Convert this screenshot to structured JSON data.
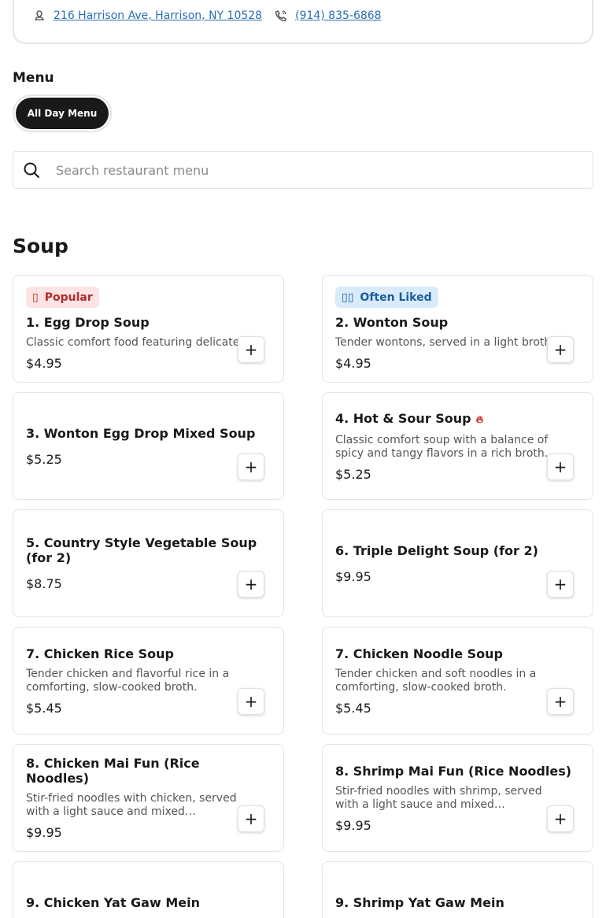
{
  "info": {
    "address": "216 Harrison Ave, Harrison, NY 10528",
    "phone": "(914) 835-6868"
  },
  "menu": {
    "heading": "Menu",
    "tab_label": "All Day Menu"
  },
  "search": {
    "placeholder": "Search restaurant menu"
  },
  "section": {
    "title": "Soup"
  },
  "badges": {
    "popular": "Popular",
    "often_liked": "Often Liked"
  },
  "items": [
    {
      "name": "1. Egg Drop Soup",
      "desc": "Classic comfort food featuring delicate ...",
      "price": "$4.95"
    },
    {
      "name": "2. Wonton Soup",
      "desc": "Tender wontons, served in a light broth.",
      "price": "$4.95"
    },
    {
      "name": "3. Wonton Egg Drop Mixed Soup",
      "desc": "",
      "price": "$5.25"
    },
    {
      "name": "4. Hot & Sour Soup",
      "desc": "Classic comfort soup with a balance of spicy and tangy flavors in a rich broth.",
      "price": "$5.25"
    },
    {
      "name": "5. Country Style Vegetable Soup (for 2)",
      "desc": "",
      "price": "$8.75"
    },
    {
      "name": "6. Triple Delight Soup (for 2)",
      "desc": "",
      "price": "$9.95"
    },
    {
      "name": "7. Chicken Rice Soup",
      "desc": "Tender chicken and flavorful rice in a comforting, slow-cooked broth.",
      "price": "$5.45"
    },
    {
      "name": "7. Chicken Noodle Soup",
      "desc": "Tender chicken and soft noodles in a comforting, slow-cooked broth.",
      "price": "$5.45"
    },
    {
      "name": "8. Chicken Mai Fun (Rice Noodles)",
      "desc": "Stir-fried noodles with chicken, served with a light sauce and mixed vegetables.",
      "price": "$9.95"
    },
    {
      "name": "8. Shrimp Mai Fun (Rice Noodles)",
      "desc": "Stir-fried noodles with shrimp, served with a light sauce and mixed vegetables.",
      "price": "$9.95"
    },
    {
      "name": "9. Chicken Yat Gaw Mein",
      "desc": "",
      "price": ""
    },
    {
      "name": "9. Shrimp Yat Gaw Mein",
      "desc": "",
      "price": ""
    }
  ],
  "add_label": "+",
  "colors": {
    "link": "#2a6db0",
    "popular_bg": "#fde3e3",
    "popular_text": "#b12b2b",
    "liked_bg": "#d9ebfb",
    "liked_text": "#1b5e9c",
    "pill_bg": "#191919"
  },
  "icons": {
    "address": "location-pin-icon",
    "phone": "phone-icon",
    "search": "search-icon",
    "popular": "popular-icon",
    "liked": "often-liked-icon",
    "spicy": "fire-icon"
  }
}
